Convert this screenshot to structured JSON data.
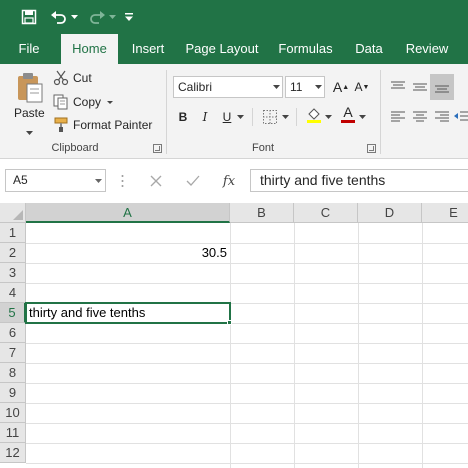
{
  "quick_access": {
    "save_icon": "save-icon",
    "undo_icon": "undo-icon",
    "redo_icon": "redo-icon",
    "customize_icon": "customize-qat-icon"
  },
  "tabs": [
    {
      "label": "File"
    },
    {
      "label": "Home",
      "active": true
    },
    {
      "label": "Insert"
    },
    {
      "label": "Page Layout"
    },
    {
      "label": "Formulas"
    },
    {
      "label": "Data"
    },
    {
      "label": "Review"
    }
  ],
  "clipboard": {
    "paste_label": "Paste",
    "cut_label": "Cut",
    "copy_label": "Copy",
    "format_painter_label": "Format Painter",
    "group_label": "Clipboard"
  },
  "font": {
    "font_name": "Calibri",
    "font_size": "11",
    "bold": "B",
    "italic": "I",
    "underline": "U",
    "grow_label": "A",
    "shrink_label": "A",
    "font_color_label": "A",
    "group_label": "Font"
  },
  "formula_bar": {
    "name_box": "A5",
    "fx_label": "fx",
    "content": "thirty and five tenths"
  },
  "sheet": {
    "columns": [
      "A",
      "B",
      "C",
      "D",
      "E"
    ],
    "rows": [
      "1",
      "2",
      "3",
      "4",
      "5",
      "6",
      "7",
      "8",
      "9",
      "10",
      "11",
      "12"
    ],
    "cells": {
      "A2": "30.5",
      "A5": "thirty and five tenths"
    },
    "selected_cell": "A5"
  },
  "colors": {
    "accent": "#217346",
    "ribbon_bg": "#f3f3f3",
    "header_bg": "#e6e6e6",
    "gridline": "#e1e1e1"
  }
}
